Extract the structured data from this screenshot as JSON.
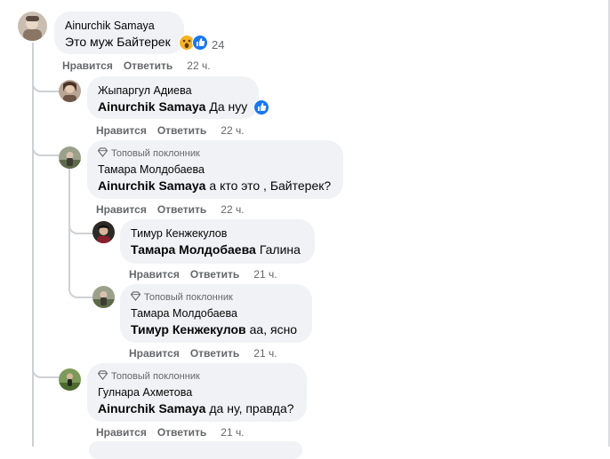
{
  "comments": [
    {
      "author": "Ainurchik Samaya",
      "mention": "",
      "text": "Это муж Байтерек",
      "badge": "",
      "like": "Нравится",
      "reply": "Ответить",
      "time": "22 ч.",
      "reaction_count": "24"
    },
    {
      "author": "Жыпаргул Адиева",
      "mention": "Ainurchik Samaya",
      "text": "Да нуу",
      "badge": "",
      "like": "Нравится",
      "reply": "Ответить",
      "time": "22 ч."
    },
    {
      "author": "Тамара Молдобаева",
      "mention": "Ainurchik Samaya",
      "text": "а кто это , Байтерек?",
      "badge": "Топовый поклонник",
      "like": "Нравится",
      "reply": "Ответить",
      "time": "22 ч."
    },
    {
      "author": "Тимур Кенжекулов",
      "mention": "Тамара Молдобаева",
      "text": "Галина",
      "badge": "",
      "like": "Нравится",
      "reply": "Ответить",
      "time": "21 ч."
    },
    {
      "author": "Тамара Молдобаева",
      "mention": "Тимур Кенжекулов",
      "text": "аа, ясно",
      "badge": "Топовый поклонник",
      "like": "Нравится",
      "reply": "Ответить",
      "time": "21 ч."
    },
    {
      "author": "Гулнара Ахметова",
      "mention": "Ainurchik Samaya",
      "text": "да ну, правда?",
      "badge": "Топовый поклонник",
      "like": "Нравится",
      "reply": "Ответить",
      "time": "21 ч."
    }
  ],
  "colors": {
    "bubble": "#f0f2f5",
    "meta": "#65676b",
    "like_blue": "#1877f2",
    "line": "#ced0d4"
  },
  "icons": {
    "reaction_wow": "wow-emoji-icon",
    "reaction_like": "like-thumb-icon",
    "badge": "diamond-icon"
  }
}
